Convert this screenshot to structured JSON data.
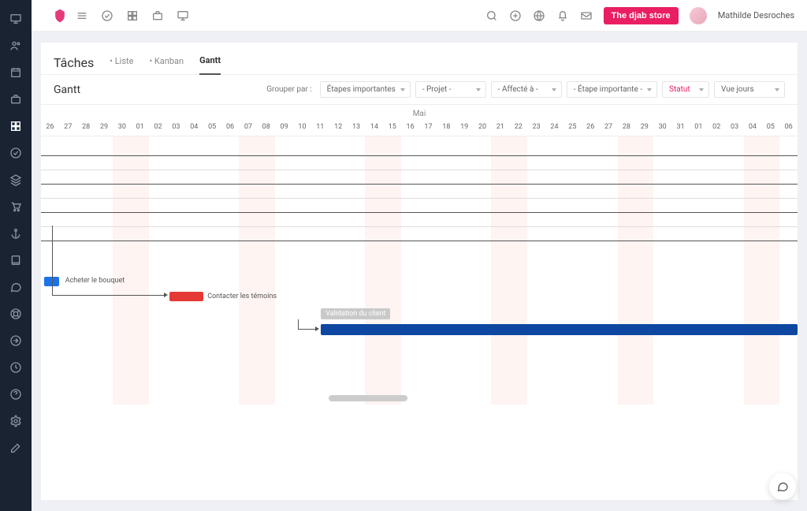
{
  "header": {
    "store_btn": "The djab store",
    "user_name": "Mathilde Desroches"
  },
  "tabs": {
    "title": "Tâches",
    "t1": "• Liste",
    "t2": "• Kanban",
    "t3": "Gantt"
  },
  "filters": {
    "subtitle": "Gantt",
    "group_by": "Grouper par :",
    "f1": "Étapes importantes",
    "f2": "- Projet -",
    "f3": "- Affecté à -",
    "f4": "- Étape importante -",
    "f5": "Statut",
    "f6": "Vue jours"
  },
  "gantt": {
    "month": "Mai",
    "days": [
      "26",
      "27",
      "28",
      "29",
      "30",
      "01",
      "02",
      "03",
      "04",
      "05",
      "06",
      "07",
      "08",
      "09",
      "10",
      "11",
      "12",
      "13",
      "14",
      "15",
      "16",
      "17",
      "18",
      "19",
      "20",
      "21",
      "22",
      "23",
      "24",
      "25",
      "26",
      "27",
      "28",
      "29",
      "30",
      "31",
      "01",
      "02",
      "03",
      "04",
      "05",
      "06"
    ],
    "weekend_idx": [
      4,
      5,
      11,
      12,
      18,
      19,
      25,
      26,
      32,
      33,
      39,
      40
    ],
    "task1_label": "Acheter le bouquet",
    "task2_label": "Contacter les témoins",
    "milestone_label": "Validation du client"
  },
  "colors": {
    "accent": "#e91e63",
    "blue": "#1a73e8",
    "darkblue": "#0d47a1",
    "red": "#e53935"
  },
  "icons": {
    "logo": "logo",
    "menu": "menu",
    "check": "check-circle",
    "grid": "grid",
    "briefcase": "briefcase",
    "monitor": "monitor",
    "search": "search",
    "plus": "plus-circle",
    "globe": "globe",
    "bell": "bell",
    "mail": "mail"
  }
}
